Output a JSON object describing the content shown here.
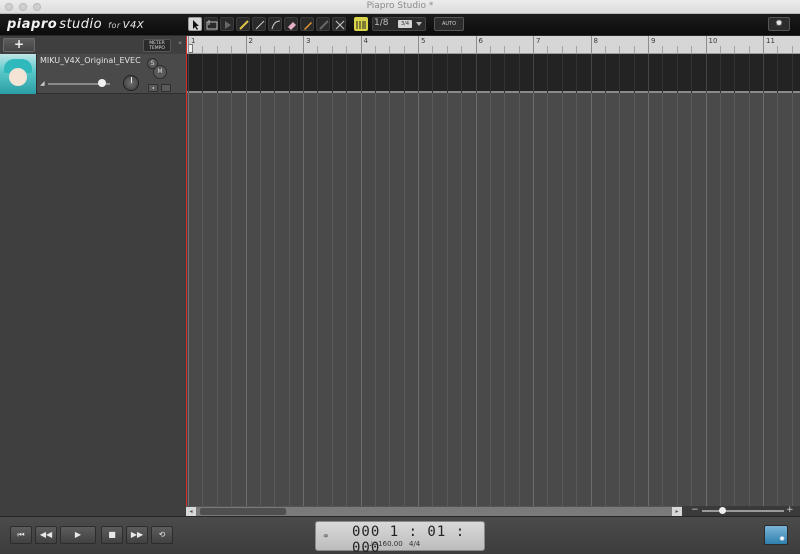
{
  "window": {
    "title": "Piapro Studio *"
  },
  "logo": {
    "brand": "piapro",
    "studio": "studio",
    "for": "for",
    "product": "V4X"
  },
  "toolbar": {
    "tools": [
      "pointer-tool",
      "select-range-tool",
      "nudge-tool",
      "pencil-tool",
      "line-tool",
      "curve-tool",
      "eraser-tool",
      "pen-tool",
      "knife-tool",
      "cut-tool"
    ],
    "quantize_value": "1/8",
    "triplet_badge": "3/4",
    "auto_label": "AUTO",
    "settings_icon": "gear-icon"
  },
  "track_panel": {
    "add_label": "+",
    "meter_tempo_label_1": "METER",
    "meter_tempo_label_2": "TEMPO"
  },
  "track": {
    "name": "MIKU_V4X_Original_EVEC",
    "solo_label": "S",
    "mute_label": "M",
    "volume_level": 0.83
  },
  "ruler": {
    "bars": [
      "1",
      "2",
      "3",
      "4",
      "5",
      "6",
      "7",
      "8",
      "9",
      "10",
      "11"
    ]
  },
  "transport": {
    "position": "000 1 : 01 : 000",
    "tempo": "♩=160.00",
    "meter": "4/4"
  },
  "colors": {
    "playhead": "#cc2f2f",
    "accent": "#d9d44a",
    "miku_teal": "#2fb9bc"
  }
}
